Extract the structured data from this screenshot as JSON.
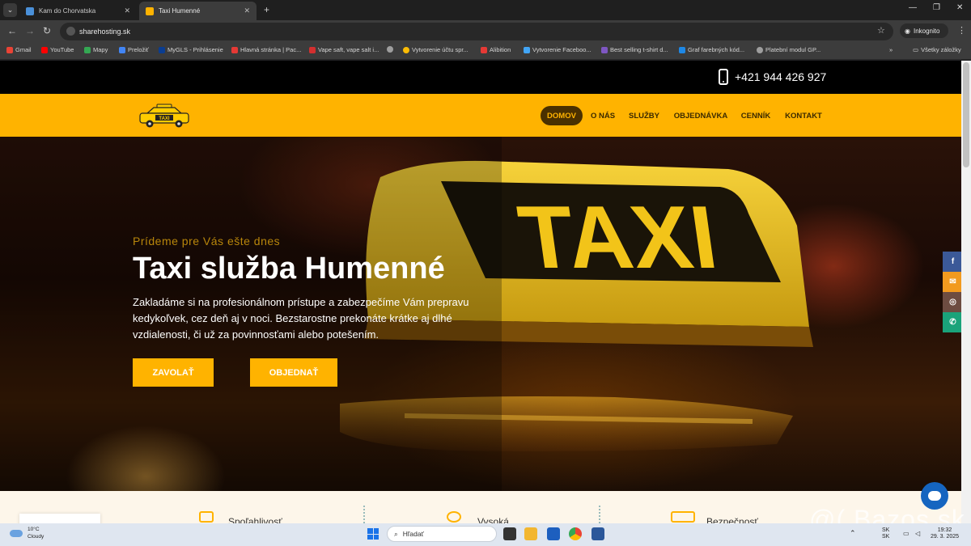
{
  "browser": {
    "tabs": [
      {
        "title": "Kam do Chorvatska",
        "favicon_color": "#4a90d9"
      },
      {
        "title": "Taxi Humenné",
        "favicon_color": "#ffb300"
      }
    ],
    "new_tab": "+",
    "url": "sharehosting.sk",
    "incognito_label": "Inkognito",
    "bookmarks": [
      {
        "label": "Gmail",
        "color": "#ea4335"
      },
      {
        "label": "YouTube",
        "color": "#ff0000"
      },
      {
        "label": "Mapy",
        "color": "#34a853"
      },
      {
        "label": "Preložiť",
        "color": "#4285f4"
      },
      {
        "label": "MyGLS - Prihlásenie",
        "color": "#0a3d91"
      },
      {
        "label": "Hlavná stránka | Pac...",
        "color": "#e53935"
      },
      {
        "label": "Vape saft, vape salt i...",
        "color": "#d32f2f"
      },
      {
        "label": "",
        "color": "#9e9e9e"
      },
      {
        "label": "Vytvorenie účtu spr...",
        "color": "#fbbc05"
      },
      {
        "label": "Alibition",
        "color": "#e53935"
      },
      {
        "label": "Vytvorenie Faceboo...",
        "color": "#42a5f5"
      },
      {
        "label": "Best selling t-shirt d...",
        "color": "#7e57c2"
      },
      {
        "label": "Graf farebných kód...",
        "color": "#1e88e5"
      },
      {
        "label": "Platební modul GP...",
        "color": "#9e9e9e"
      }
    ],
    "all_bookmarks": "Všetky záložky"
  },
  "site": {
    "phone": "+421 944 426 927",
    "logo_text": "TAXI",
    "nav": [
      "DOMOV",
      "O NÁS",
      "SLUŽBY",
      "OBJEDNÁVKA",
      "CENNÍK",
      "KONTAKT"
    ],
    "hero": {
      "eyebrow": "Prídeme pre Vás ešte dnes",
      "title": "Taxi služba Humenné",
      "description": "Zakladáme si na profesionálnom prístupe a zabezpečíme Vám prepravu kedykoľvek, cez deň aj v noci. Bezstarostne prekonáte krátke aj dlhé vzdialenosti, či už za povinnosťami alebo potešením.",
      "sign_text": "TAXI",
      "call_button": "ZAVOLAŤ",
      "order_button": "OBJEDNAŤ"
    },
    "features": [
      {
        "title": "Spoľahlivosť"
      },
      {
        "title": "Vysoká"
      },
      {
        "title": "Bezpečnosť"
      }
    ],
    "social": [
      {
        "icon": "facebook-icon",
        "glyph": "f",
        "color": "#3b5998"
      },
      {
        "icon": "email-icon",
        "glyph": "✉",
        "color": "#f29a1f"
      },
      {
        "icon": "instagram-icon",
        "glyph": "◎",
        "color": "#6d4c41"
      },
      {
        "icon": "whatsapp-icon",
        "glyph": "✆",
        "color": "#1aa37a"
      }
    ],
    "accent_color": "#ffb300"
  },
  "watermark": "@( Bazos.sk",
  "taskbar": {
    "temperature": "10°C",
    "weather": "Cloudy",
    "search_placeholder": "Hľadať",
    "lang": "SK",
    "lang2": "SK",
    "time": "19:32",
    "date": "29. 3. 2025"
  }
}
